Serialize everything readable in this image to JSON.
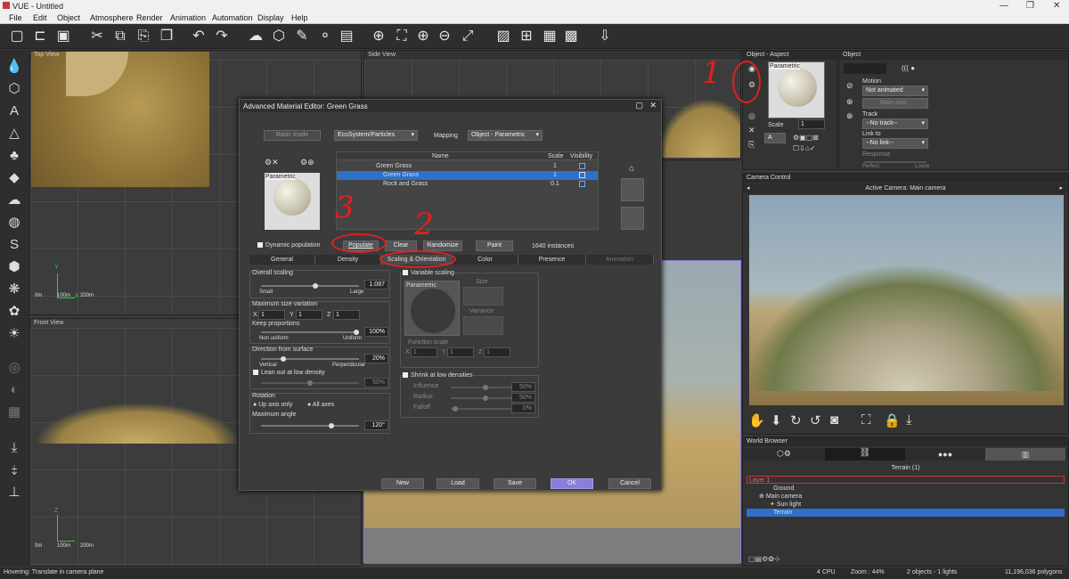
{
  "window": {
    "title": "VUE - Untitled"
  },
  "menu": [
    "File",
    "Edit",
    "Object",
    "Atmosphere",
    "Render",
    "Animation",
    "Automation",
    "Display",
    "Help"
  ],
  "viewports": {
    "top_left": {
      "label": "Top View"
    },
    "side": {
      "label": "Side View"
    },
    "front": {
      "label": "Front View"
    },
    "scale": {
      "s0": "0m",
      "s1": "100m",
      "s2": "200m"
    },
    "axes": {
      "x": "X",
      "y": "Y",
      "z": "Z"
    }
  },
  "dialog": {
    "title": "Advanced Material Editor: Green Grass",
    "basic_mode": "Basic mode",
    "material_type": "EcoSystem/Particles",
    "mapping_label": "Mapping",
    "mapping_value": "Object - Parametric",
    "preview_label": "Parametric",
    "table": {
      "headers": [
        "Name",
        "Scale",
        "Visibility"
      ],
      "rows": [
        {
          "name": "Green Grass",
          "scale": "1"
        },
        {
          "name": "Green Grass",
          "scale": "1"
        },
        {
          "name": "Rock and Grass",
          "scale": "0.1"
        }
      ]
    },
    "dynamic_population": "Dynamic population",
    "buttons": {
      "populate": "Populate",
      "clear": "Clear",
      "randomize": "Randomize",
      "paint": "Paint"
    },
    "instances": "1640 instances",
    "tabs": [
      "General",
      "Density",
      "Scaling & Orientation",
      "Color",
      "Presence",
      "Animation"
    ],
    "overall_scaling": {
      "label": "Overall scaling",
      "value": "1.087",
      "small": "Small",
      "large": "Large"
    },
    "max_size": {
      "label": "Maximum size variation",
      "x": "1",
      "y": "1",
      "z": "1",
      "xl": "X",
      "yl": "Y",
      "zl": "Z"
    },
    "keep_proportions": {
      "label": "Keep proportions",
      "value": "100%",
      "left": "Non uniform",
      "right": "Uniform"
    },
    "direction": {
      "label": "Direction from surface",
      "value": "20%",
      "left": "Vertical",
      "right": "Perpendicular"
    },
    "lean": {
      "label": "Lean out at low density",
      "value": "50%"
    },
    "rotation": {
      "label": "Rotation",
      "up": "Up axis only",
      "all": "All axes"
    },
    "max_angle": {
      "label": "Maximum angle",
      "value": "120°"
    },
    "variable_scaling": {
      "label": "Variable scaling",
      "param": "Parametric",
      "size": "Size",
      "variance": "Variance",
      "function_scale": "Function scale",
      "fx": "1",
      "fy": "1",
      "fz": "1"
    },
    "shrink": {
      "label": "Shrink at low densities",
      "influence": "Influence",
      "influence_v": "50%",
      "radius": "Radius",
      "radius_v": "50%",
      "falloff": "Falloff",
      "falloff_v": "0%"
    },
    "footer": {
      "new": "New",
      "load": "Load",
      "save": "Save",
      "ok": "OK",
      "cancel": "Cancel"
    }
  },
  "object_aspect": {
    "title": "Object - Aspect",
    "preview": "Parametric",
    "scale_label": "Scale",
    "scale_value": "1",
    "channel": "A"
  },
  "object_panel": {
    "title": "Object",
    "motion_label": "Motion",
    "motion_value": "Not animated",
    "main_axis": "Main axis",
    "track_label": "Track",
    "track_value": "--No track--",
    "link_label": "Link to",
    "link_value": "--No link--",
    "response": "Response",
    "perfect": "Perfect",
    "loose": "Loose"
  },
  "camera_control": {
    "title": "Camera Control",
    "active": "Active Camera: Main camera"
  },
  "world_browser": {
    "title": "World Browser",
    "terrain_header": "Terrain (1)",
    "items": [
      "Layer 1",
      "Ground",
      "Main camera",
      "Sun light",
      "Terrain"
    ]
  },
  "status": {
    "hover": "Hovering: Translate in camera plane",
    "cpu": "4 CPU",
    "zoom": "Zoom : 44%",
    "objects": "2 objects - 1 lights",
    "polygons": "11,196,036 polygons"
  },
  "annotations": {
    "n1": "1",
    "n2": "2",
    "n3": "3"
  },
  "colors": {
    "accent": "#3070c8",
    "annotation": "#e02020",
    "ok_button": "#8a7fd8"
  }
}
